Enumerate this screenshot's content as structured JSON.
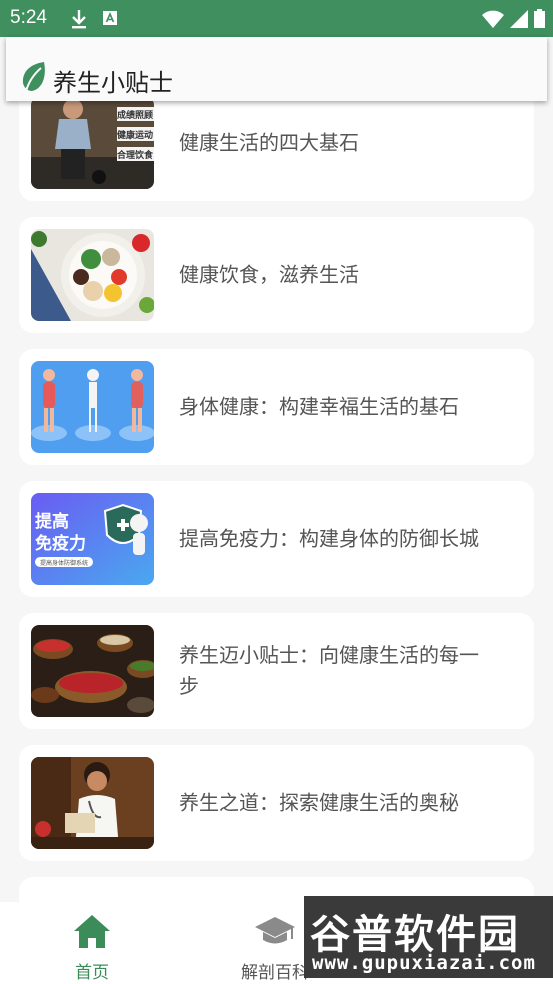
{
  "status_bar": {
    "time": "5:24",
    "icons": [
      "download-icon",
      "a-box-icon",
      "wifi-icon",
      "signal-icon",
      "battery-icon"
    ]
  },
  "app_bar": {
    "title": "养生小贴士",
    "logo": "leaf-icon"
  },
  "colors": {
    "primary": "#3f8f5f",
    "nav_active": "#3c8c5a",
    "nav_inactive": "#888888",
    "card_bg": "#ffffff",
    "page_bg": "#f6f6f6"
  },
  "articles": [
    {
      "title": "健康生活的四大基石"
    },
    {
      "title": "健康饮食，滋养生活"
    },
    {
      "title": "身体健康：构建幸福生活的基石"
    },
    {
      "title": "提高免疫力：构建身体的防御长城"
    },
    {
      "title": "养生迈小贴士：向健康生活的每一步"
    },
    {
      "title": "养生之道：探索健康生活的奥秘"
    }
  ],
  "thumbs": {
    "t1": [
      "成绩照顾",
      "健康运动",
      "合理饮食"
    ],
    "t4_title": "提高\n免疫力",
    "t4_sub": "提高身体防御系统"
  },
  "bottom_nav": {
    "home": {
      "label": "首页",
      "icon": "home-icon"
    },
    "anatomy": {
      "label": "解剖百科",
      "icon": "graduation-cap-icon"
    }
  },
  "watermark": {
    "big": "谷普软件园",
    "small": "www.gupuxiazai.com"
  }
}
